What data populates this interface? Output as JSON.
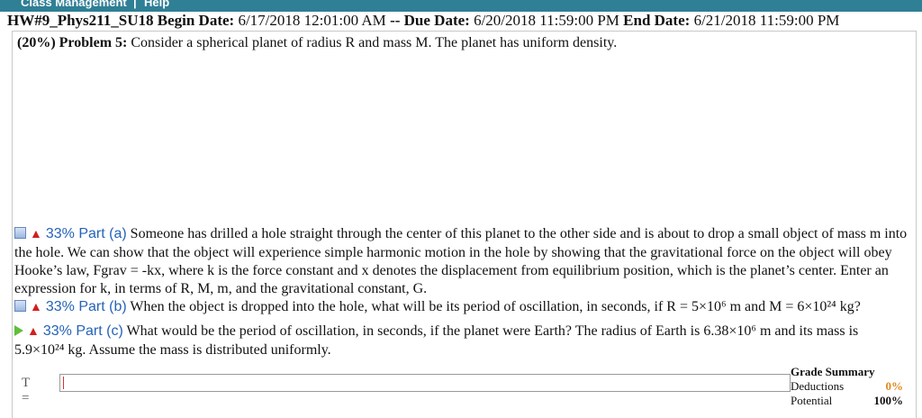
{
  "topbar": {
    "item1": "Class Management",
    "separator": "|",
    "item2": "Help"
  },
  "assignment": {
    "hw": "HW#9_Phys211_SU18",
    "begin_label": "Begin Date:",
    "begin": "6/17/2018 12:01:00 AM",
    "dash": "--",
    "due_label": "Due Date:",
    "due": "6/20/2018 11:59:00 PM",
    "end_label": "End Date:",
    "end": "6/21/2018 11:59:00 PM"
  },
  "problem": {
    "weight": "(20%)",
    "label": "Problem 5:",
    "text": "Consider a spherical planet of radius R and mass M. The planet has uniform density."
  },
  "parts": [
    {
      "label": "33% Part (a)",
      "text": "Someone has drilled a hole straight through the center of this planet to the other side and is about to drop a small object of mass m into the hole. We can show that the object will experience simple harmonic motion in the hole by showing that the gravitational force on the object will obey Hooke’s law, Fgrav = -kx, where k is the force constant and x denotes the displacement from equilibrium position, which is the planet’s center. Enter an expression for k, in terms of R, M, m, and the gravitational constant, G."
    },
    {
      "label": "33% Part (b)",
      "text": "When the object is dropped into the hole, what will be its period of oscillation, in seconds, if R = 5×10⁶ m and M = 6×10²⁴ kg?"
    },
    {
      "label": "33% Part (c)",
      "text": "What would be the period of oscillation, in seconds, if the planet were Earth? The radius of Earth is 6.38×10⁶ m and its mass is 5.9×10²⁴ kg. Assume the mass is distributed uniformly."
    }
  ],
  "answer": {
    "label": "T =",
    "value": ""
  },
  "grade": {
    "title": "Grade Summary",
    "deductions_label": "Deductions",
    "deductions": "0%",
    "potential_label": "Potential",
    "potential": "100%"
  }
}
